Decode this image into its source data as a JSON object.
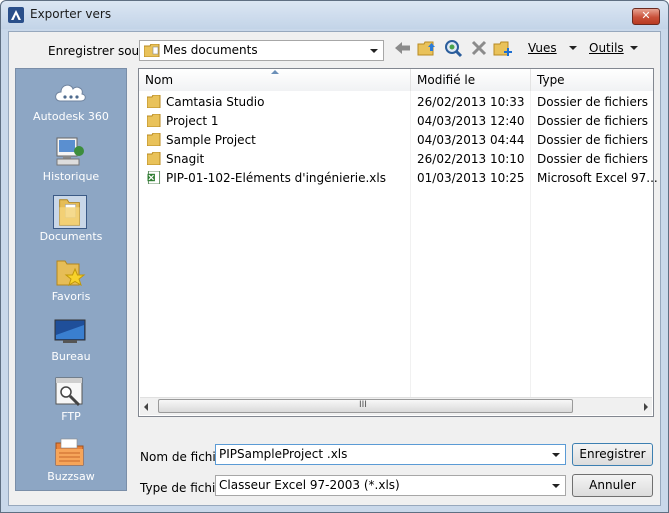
{
  "window": {
    "title": "Exporter vers",
    "close_label": "✕"
  },
  "save_in": {
    "label": "Enregistrer sous:",
    "value": "Mes documents"
  },
  "toolbar": {
    "views_label": "Vues",
    "tools_label": "Outils"
  },
  "places": [
    {
      "label": "Autodesk 360",
      "icon": "cloud-icon"
    },
    {
      "label": "Historique",
      "icon": "history-icon"
    },
    {
      "label": "Documents",
      "icon": "documents-folder-icon",
      "selected": true
    },
    {
      "label": "Favoris",
      "icon": "favorites-icon"
    },
    {
      "label": "Bureau",
      "icon": "desktop-icon"
    },
    {
      "label": "FTP",
      "icon": "ftp-icon"
    },
    {
      "label": "Buzzsaw",
      "icon": "buzzsaw-icon"
    }
  ],
  "columns": {
    "name": "Nom",
    "modified": "Modifié le",
    "type": "Type"
  },
  "files": [
    {
      "name": "Camtasia Studio",
      "modified": "26/02/2013 10:33",
      "type": "Dossier de fichiers",
      "kind": "folder"
    },
    {
      "name": "Project 1",
      "modified": "04/03/2013 12:40",
      "type": "Dossier de fichiers",
      "kind": "folder"
    },
    {
      "name": "Sample Project",
      "modified": "04/03/2013 04:44",
      "type": "Dossier de fichiers",
      "kind": "folder"
    },
    {
      "name": "Snagit",
      "modified": "26/02/2013 10:10",
      "type": "Dossier de fichiers",
      "kind": "folder"
    },
    {
      "name": "PIP-01-102-Eléments d'ingénierie.xls",
      "modified": "01/03/2013 10:25",
      "type": "Microsoft Excel 97...",
      "kind": "excel"
    }
  ],
  "scroll": {
    "thumb_label": "III"
  },
  "filename": {
    "label": "Nom de fichier:",
    "value": "PIPSampleProject .xls"
  },
  "filetype": {
    "label": "Type de fichier:",
    "value": "Classeur Excel 97-2003 (*.xls)"
  },
  "buttons": {
    "save": "Enregistrer",
    "cancel": "Annuler"
  }
}
